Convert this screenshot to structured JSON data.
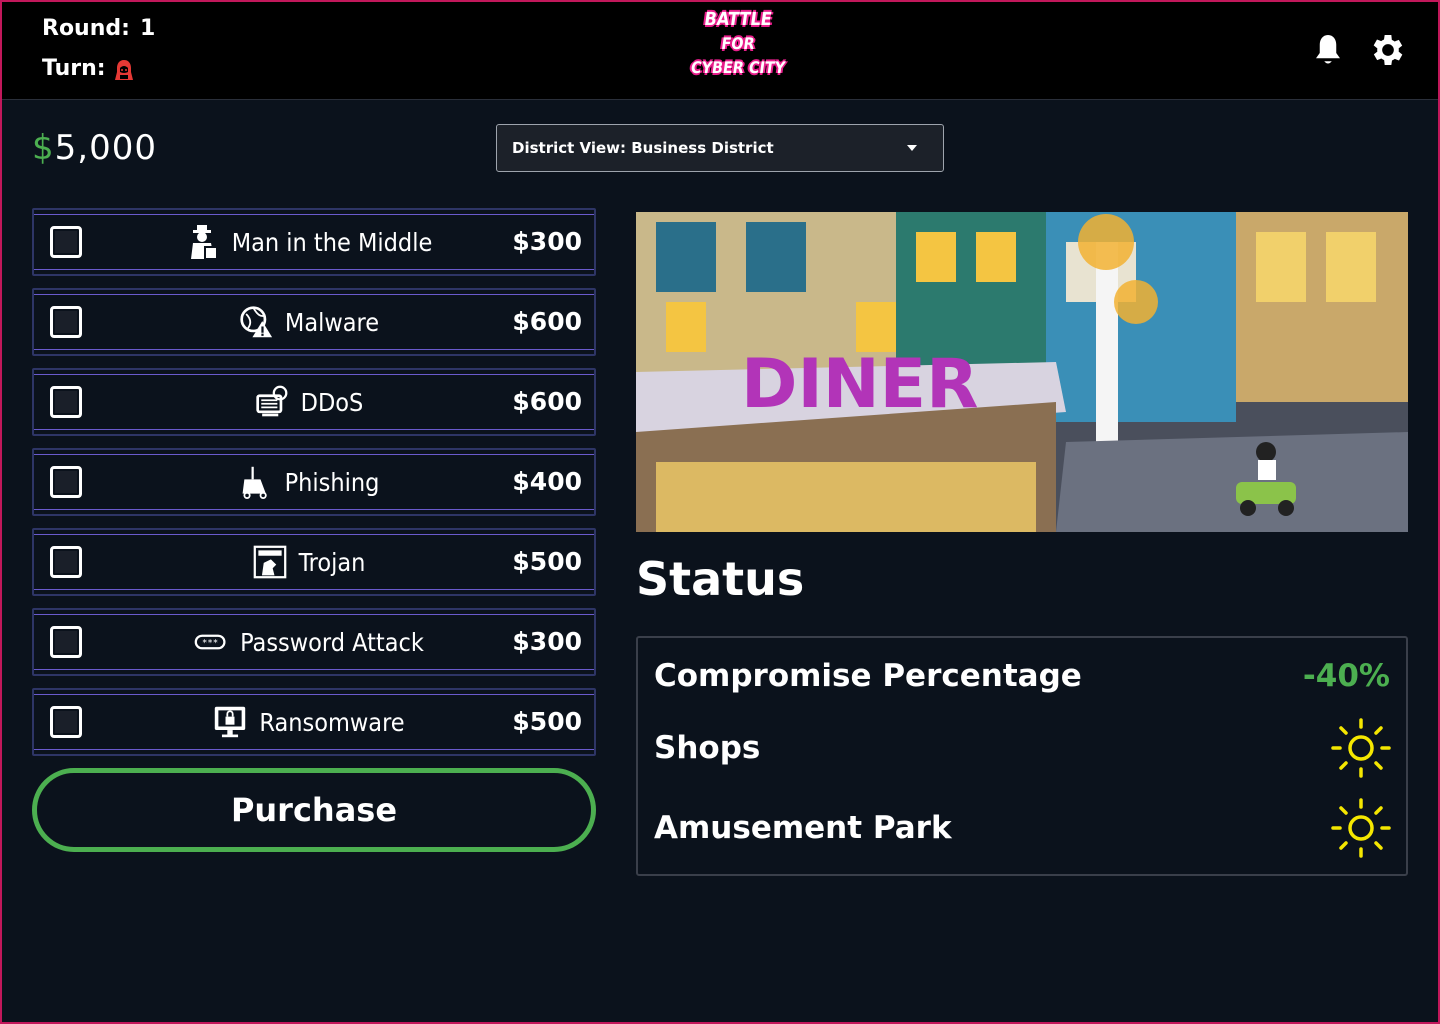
{
  "header": {
    "round_label": "Round:",
    "round_value": "1",
    "turn_label": "Turn:",
    "turn_icon": "hacker-icon",
    "logo_lines": [
      "BATTLE",
      "FOR",
      "CYBER CITY"
    ]
  },
  "money": {
    "currency": "$",
    "amount": "5,000"
  },
  "district": {
    "label": "District View: Business District"
  },
  "attacks": [
    {
      "label": "Man in the Middle",
      "price": "$300",
      "icon": "spy-icon"
    },
    {
      "label": "Malware",
      "price": "$600",
      "icon": "malware-icon"
    },
    {
      "label": "DDoS",
      "price": "$600",
      "icon": "ddos-icon"
    },
    {
      "label": "Phishing",
      "price": "$400",
      "icon": "phishing-icon"
    },
    {
      "label": "Trojan",
      "price": "$500",
      "icon": "trojan-icon"
    },
    {
      "label": "Password Attack",
      "price": "$300",
      "icon": "password-icon"
    },
    {
      "label": "Ransomware",
      "price": "$500",
      "icon": "ransomware-icon"
    }
  ],
  "purchase_label": "Purchase",
  "status": {
    "title": "Status",
    "rows": [
      {
        "label": "Compromise Percentage",
        "value": "-40%"
      },
      {
        "label": "Shops",
        "icon": "sun-icon"
      },
      {
        "label": "Amusement Park",
        "icon": "sun-icon"
      }
    ]
  },
  "colors": {
    "background": "#0b121c",
    "accent_green": "#4caf50",
    "logo_pink": "#e91e8c",
    "sun_yellow": "#f5e700",
    "turn_icon_red": "#e53935"
  }
}
